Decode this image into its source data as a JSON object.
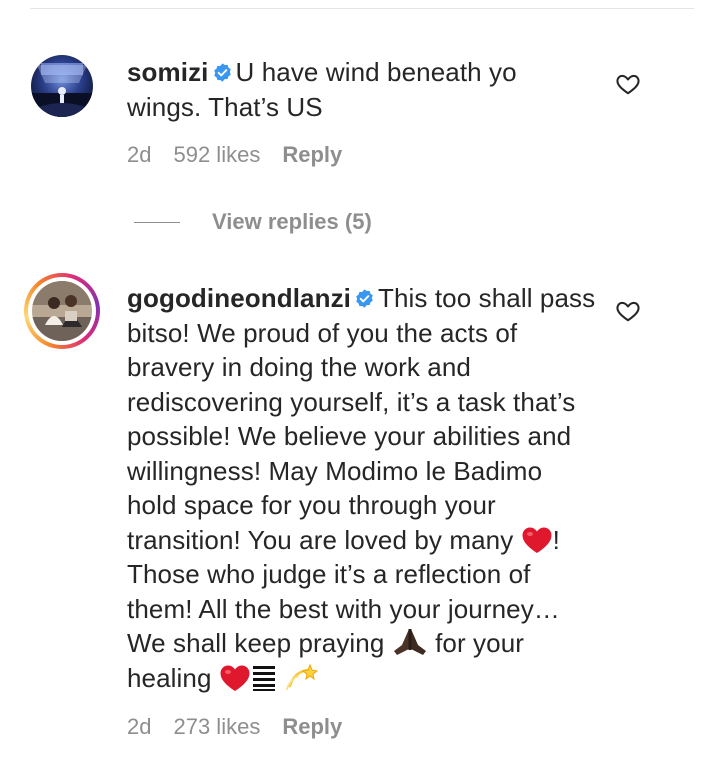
{
  "comments": [
    {
      "username": "somizi",
      "text": "U have wind beneath yo wings. That’s US",
      "time": "2d",
      "likes": "592 likes",
      "reply_label": "Reply",
      "verified": true,
      "avatar_icon": "concert-stage-avatar",
      "view_replies": "View replies (5)"
    },
    {
      "username": "gogodineondlanzi",
      "text_part1": "This too shall pass bitso! We proud of you the acts of bravery in doing the work and rediscovering yourself, it’s a task that’s possible! We believe your abilities and willingness! May Modimo le Badimo hold space for you through your transition! You are loved by many",
      "text_part2": "! Those who judge it’s a reflection of them! All the best with your journey… We shall keep praying",
      "text_part3": "for your healing",
      "time": "2d",
      "likes": "273 likes",
      "reply_label": "Reply",
      "verified": true,
      "story_ring": true,
      "avatar_icon": "two-people-avatar"
    }
  ],
  "colors": {
    "text": "#262626",
    "secondary": "#8e8e8e",
    "verified": "#3897f0",
    "heart_emoji": "#e0182d"
  },
  "icons": [
    "verified-badge-icon",
    "heart-outline-icon",
    "red-heart-emoji",
    "praying-hands-emoji",
    "trigram-emoji",
    "dizzy-emoji"
  ]
}
